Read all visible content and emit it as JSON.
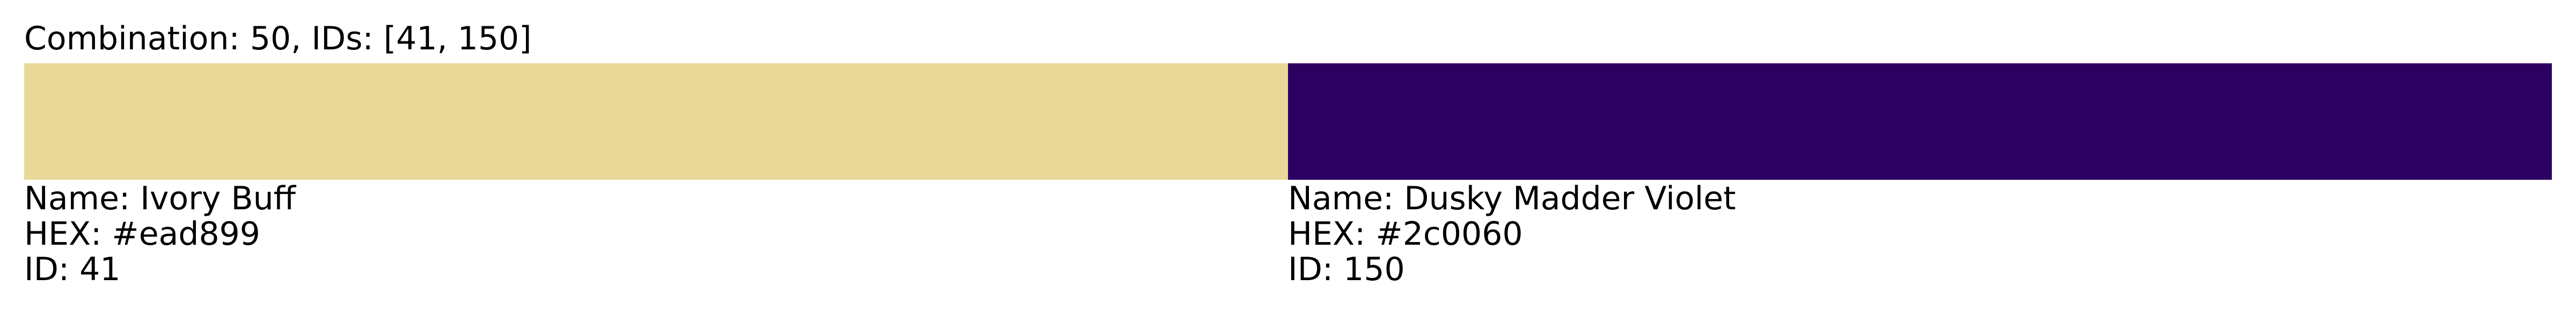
{
  "title": "Combination: 50, IDs: [41, 150]",
  "colors": [
    {
      "name_line": "Name: Ivory Buff",
      "hex_line": "HEX: #ead899",
      "id_line": "ID: 41",
      "hex": "#ead899"
    },
    {
      "name_line": "Name: Dusky Madder Violet",
      "hex_line": "HEX: #2c0060",
      "id_line": "ID: 150",
      "hex": "#2c0060"
    }
  ]
}
